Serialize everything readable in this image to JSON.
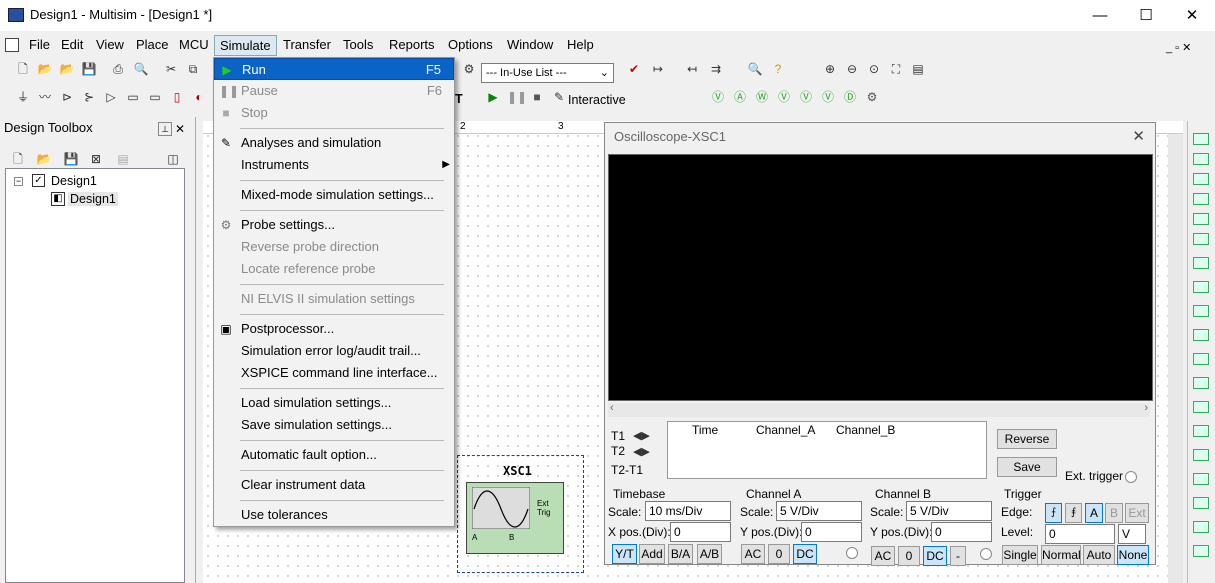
{
  "window": {
    "title": "Design1 - Multisim - [Design1 *]",
    "minimize": "—",
    "maximize": "☐",
    "close": "✕"
  },
  "menu": [
    "File",
    "Edit",
    "View",
    "Place",
    "MCU",
    "Simulate",
    "Transfer",
    "Tools",
    "Reports",
    "Options",
    "Window",
    "Help"
  ],
  "toolbar": {
    "in_use_list": "--- In-Use List ---",
    "interactive": "Interactive"
  },
  "toolbox": {
    "title": "Design Toolbox",
    "tree_root": "Design1",
    "tree_child": "Design1"
  },
  "simulate_menu": {
    "run": "Run",
    "run_sc": "F5",
    "pause": "Pause",
    "pause_sc": "F6",
    "stop": "Stop",
    "analyses": "Analyses and simulation",
    "instruments": "Instruments",
    "mixed": "Mixed-mode simulation settings...",
    "probe": "Probe settings...",
    "reverse_probe": "Reverse probe direction",
    "locate_probe": "Locate reference probe",
    "elvis": "NI ELVIS II simulation settings",
    "postprocessor": "Postprocessor...",
    "errlog": "Simulation error log/audit trail...",
    "xspice": "XSPICE command line interface...",
    "load": "Load simulation settings...",
    "save": "Save simulation settings...",
    "fault": "Automatic fault option...",
    "clear": "Clear instrument data",
    "tolerances": "Use tolerances"
  },
  "oscilloscope": {
    "title": "Oscilloscope-XSC1",
    "t1": "T1",
    "t2": "T2",
    "t2t1": "T2-T1",
    "col_time": "Time",
    "col_a": "Channel_A",
    "col_b": "Channel_B",
    "reverse": "Reverse",
    "save": "Save",
    "ext_trigger": "Ext. trigger",
    "timebase": {
      "title": "Timebase",
      "scale_label": "Scale:",
      "scale": "10 ms/Div",
      "xpos_label": "X pos.(Div):",
      "xpos": "0",
      "yt": "Y/T",
      "add": "Add",
      "ba": "B/A",
      "ab": "A/B"
    },
    "channel_a": {
      "title": "Channel A",
      "scale_label": "Scale:",
      "scale": "5  V/Div",
      "ypos_label": "Y pos.(Div):",
      "ypos": "0",
      "ac": "AC",
      "zero": "0",
      "dc": "DC"
    },
    "channel_b": {
      "title": "Channel B",
      "scale_label": "Scale:",
      "scale": "5  V/Div",
      "ypos_label": "Y pos.(Div):",
      "ypos": "0",
      "ac": "AC",
      "zero": "0",
      "dc": "DC",
      "minus": "-"
    },
    "trigger": {
      "title": "Trigger",
      "edge_label": "Edge:",
      "a": "A",
      "b": "B",
      "ext": "Ext",
      "level_label": "Level:",
      "level": "0",
      "unit": "V",
      "single": "Single",
      "normal": "Normal",
      "auto": "Auto",
      "none": "None"
    }
  },
  "schematic": {
    "instrument_name": "XSC1",
    "ext_trig": "Ext Trig",
    "pin_a": "A",
    "pin_b": "B",
    "ruler_2": "2",
    "ruler_3": "3"
  }
}
